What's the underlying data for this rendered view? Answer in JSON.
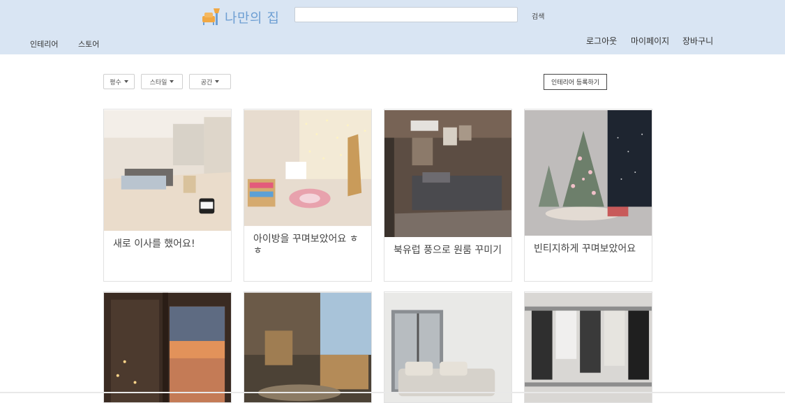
{
  "header": {
    "logo_text": "나만의 집",
    "search_placeholder": "",
    "search_button": "검색",
    "nav_left": [
      "인테리어",
      "스토어"
    ],
    "nav_right": [
      "로그아웃",
      "마이페이지",
      "장바구니"
    ]
  },
  "filters": {
    "size": "평수",
    "style": "스타일",
    "space": "공간",
    "register": "인테리어 등록하기"
  },
  "cards": [
    {
      "title": "새로 이사를 했어요!"
    },
    {
      "title": "아이방을 꾸며보았어요 ㅎㅎ"
    },
    {
      "title": "북유럽 풍으로 원룸 꾸미기"
    },
    {
      "title": "빈티지하게 꾸며보았어요"
    },
    {
      "title": ""
    },
    {
      "title": ""
    },
    {
      "title": ""
    },
    {
      "title": ""
    }
  ],
  "colors": {
    "header_bg": "#d9e5f3",
    "logo_text": "#6e9fd3",
    "logo_icon": "#f0a844"
  }
}
